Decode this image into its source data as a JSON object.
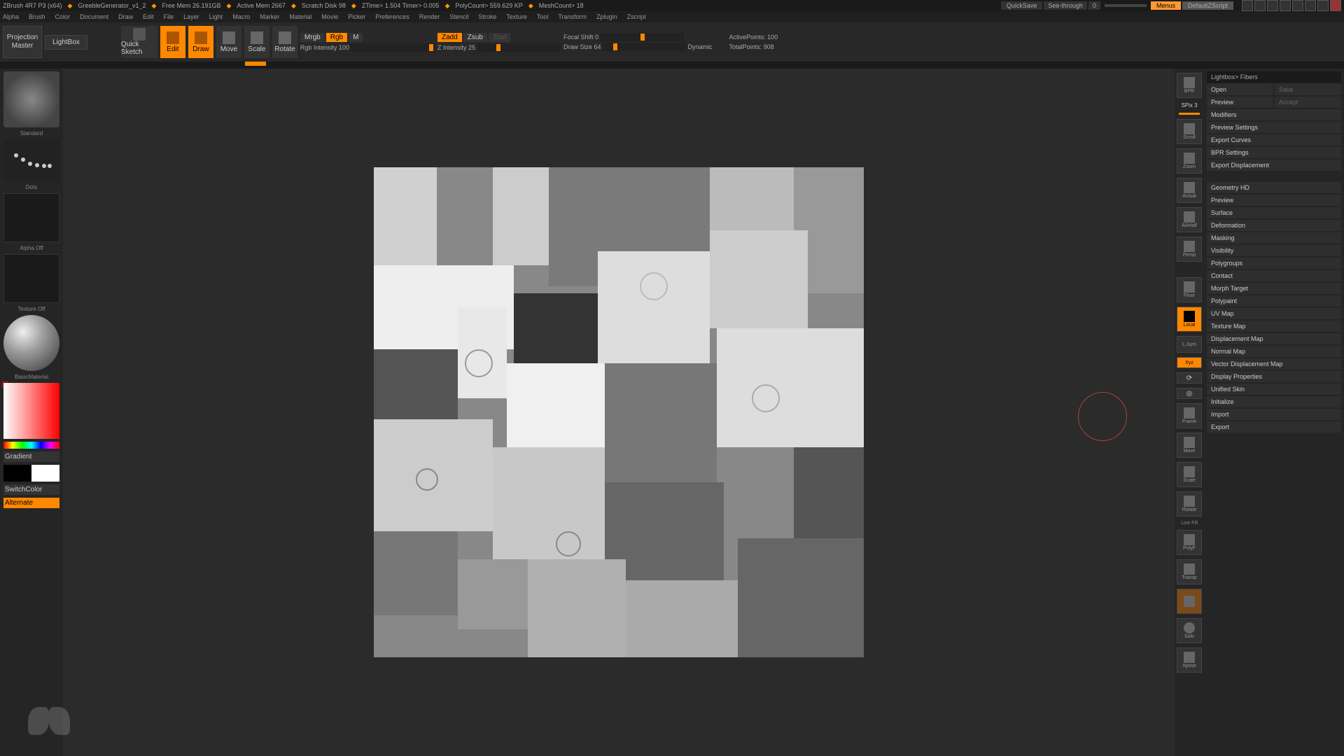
{
  "titlebar": {
    "app": "ZBrush 4R7 P3 (x64)",
    "file": "GreebleGenerator_v1_2",
    "freemem": "Free Mem 26.191GB",
    "activemem": "Active Mem 2667",
    "scratch": "Scratch Disk 98",
    "ztime": "ZTime> 1.504 Timer> 0.005",
    "polycount": "PolyCount> 559.629 KP",
    "meshcount": "MeshCount> 18",
    "quicksave": "QuickSave",
    "seethru": "See-through",
    "seethruval": "0",
    "menus": "Menus",
    "defaultzs": "DefaultZScript"
  },
  "menubar": [
    "Alpha",
    "Brush",
    "Color",
    "Document",
    "Draw",
    "Edit",
    "File",
    "Layer",
    "Light",
    "Macro",
    "Marker",
    "Material",
    "Movie",
    "Picker",
    "Preferences",
    "Render",
    "Stencil",
    "Stroke",
    "Texture",
    "Tool",
    "Transform",
    "Zplugin",
    "Zscript"
  ],
  "shelf": {
    "projmaster": "Projection Master",
    "lightbox": "LightBox",
    "qsketch": "Quick Sketch",
    "modes": [
      {
        "label": "Edit",
        "active": true
      },
      {
        "label": "Draw",
        "active": true
      },
      {
        "label": "Move",
        "active": false
      },
      {
        "label": "Scale",
        "active": false
      },
      {
        "label": "Rotate",
        "active": false
      }
    ],
    "mrgb": "Mrgb",
    "rgb": "Rgb",
    "m": "M",
    "rgbint": "Rgb Intensity 100",
    "zadd": "Zadd",
    "zsub": "Zsub",
    "zcut": "Zcut",
    "zint": "Z Intensity 25",
    "focal": "Focal Shift 0",
    "drawsize": "Draw Size 64",
    "dynamic": "Dynamic",
    "activepts": "ActivePoints: 100",
    "totalpts": "TotalPoints: 908"
  },
  "leftcol": {
    "brush": "Standard",
    "stroke": "Dots",
    "alpha": "Alpha Off",
    "texture": "Texture Off",
    "material": "BasicMaterial",
    "gradient": "Gradient",
    "switchcolor": "SwitchColor",
    "alternate": "Alternate"
  },
  "rightcol": [
    {
      "label": "BPR",
      "active": false
    },
    {
      "label": "SPix 3",
      "active": false,
      "small": true
    },
    {
      "label": "Scroll",
      "active": false
    },
    {
      "label": "Zoom",
      "active": false
    },
    {
      "label": "Actual",
      "active": false
    },
    {
      "label": "AAHalf",
      "active": false
    },
    {
      "label": "Persp",
      "active": false
    },
    {
      "label": "Floor",
      "active": false
    },
    {
      "label": "Local",
      "active": true
    },
    {
      "label": "L.Sym",
      "active": false
    },
    {
      "label": "Xyz",
      "active": true,
      "thin": true
    },
    {
      "label": "",
      "active": false,
      "thin": true
    },
    {
      "label": "",
      "active": false,
      "thin": true
    },
    {
      "label": "Frame",
      "active": false
    },
    {
      "label": "Move",
      "active": false
    },
    {
      "label": "Scale",
      "active": false
    },
    {
      "label": "Rotate",
      "active": false
    },
    {
      "label": "PolyF",
      "active": false
    },
    {
      "label": "Transp",
      "active": false
    },
    {
      "label": "",
      "active": true
    },
    {
      "label": "Solo",
      "active": false
    },
    {
      "label": "Xpose",
      "active": false
    }
  ],
  "palette": {
    "header": "Lightbox> Fibers",
    "open": "Open",
    "save": "Save",
    "preview": "Preview",
    "accept": "Accept",
    "sections1": [
      "Modifiers",
      "Preview Settings",
      "Export Curves",
      "BPR Settings",
      "Export Displacement"
    ],
    "sections2": [
      "Geometry HD",
      "Preview",
      "Surface",
      "Deformation",
      "Masking",
      "Visibility",
      "Polygroups",
      "Contact",
      "Morph Target",
      "Polypaint",
      "UV Map",
      "Texture Map",
      "Displacement Map",
      "Normal Map",
      "Vector Displacement Map",
      "Display Properties",
      "Unified Skin",
      "Initialize",
      "Import",
      "Export"
    ]
  }
}
